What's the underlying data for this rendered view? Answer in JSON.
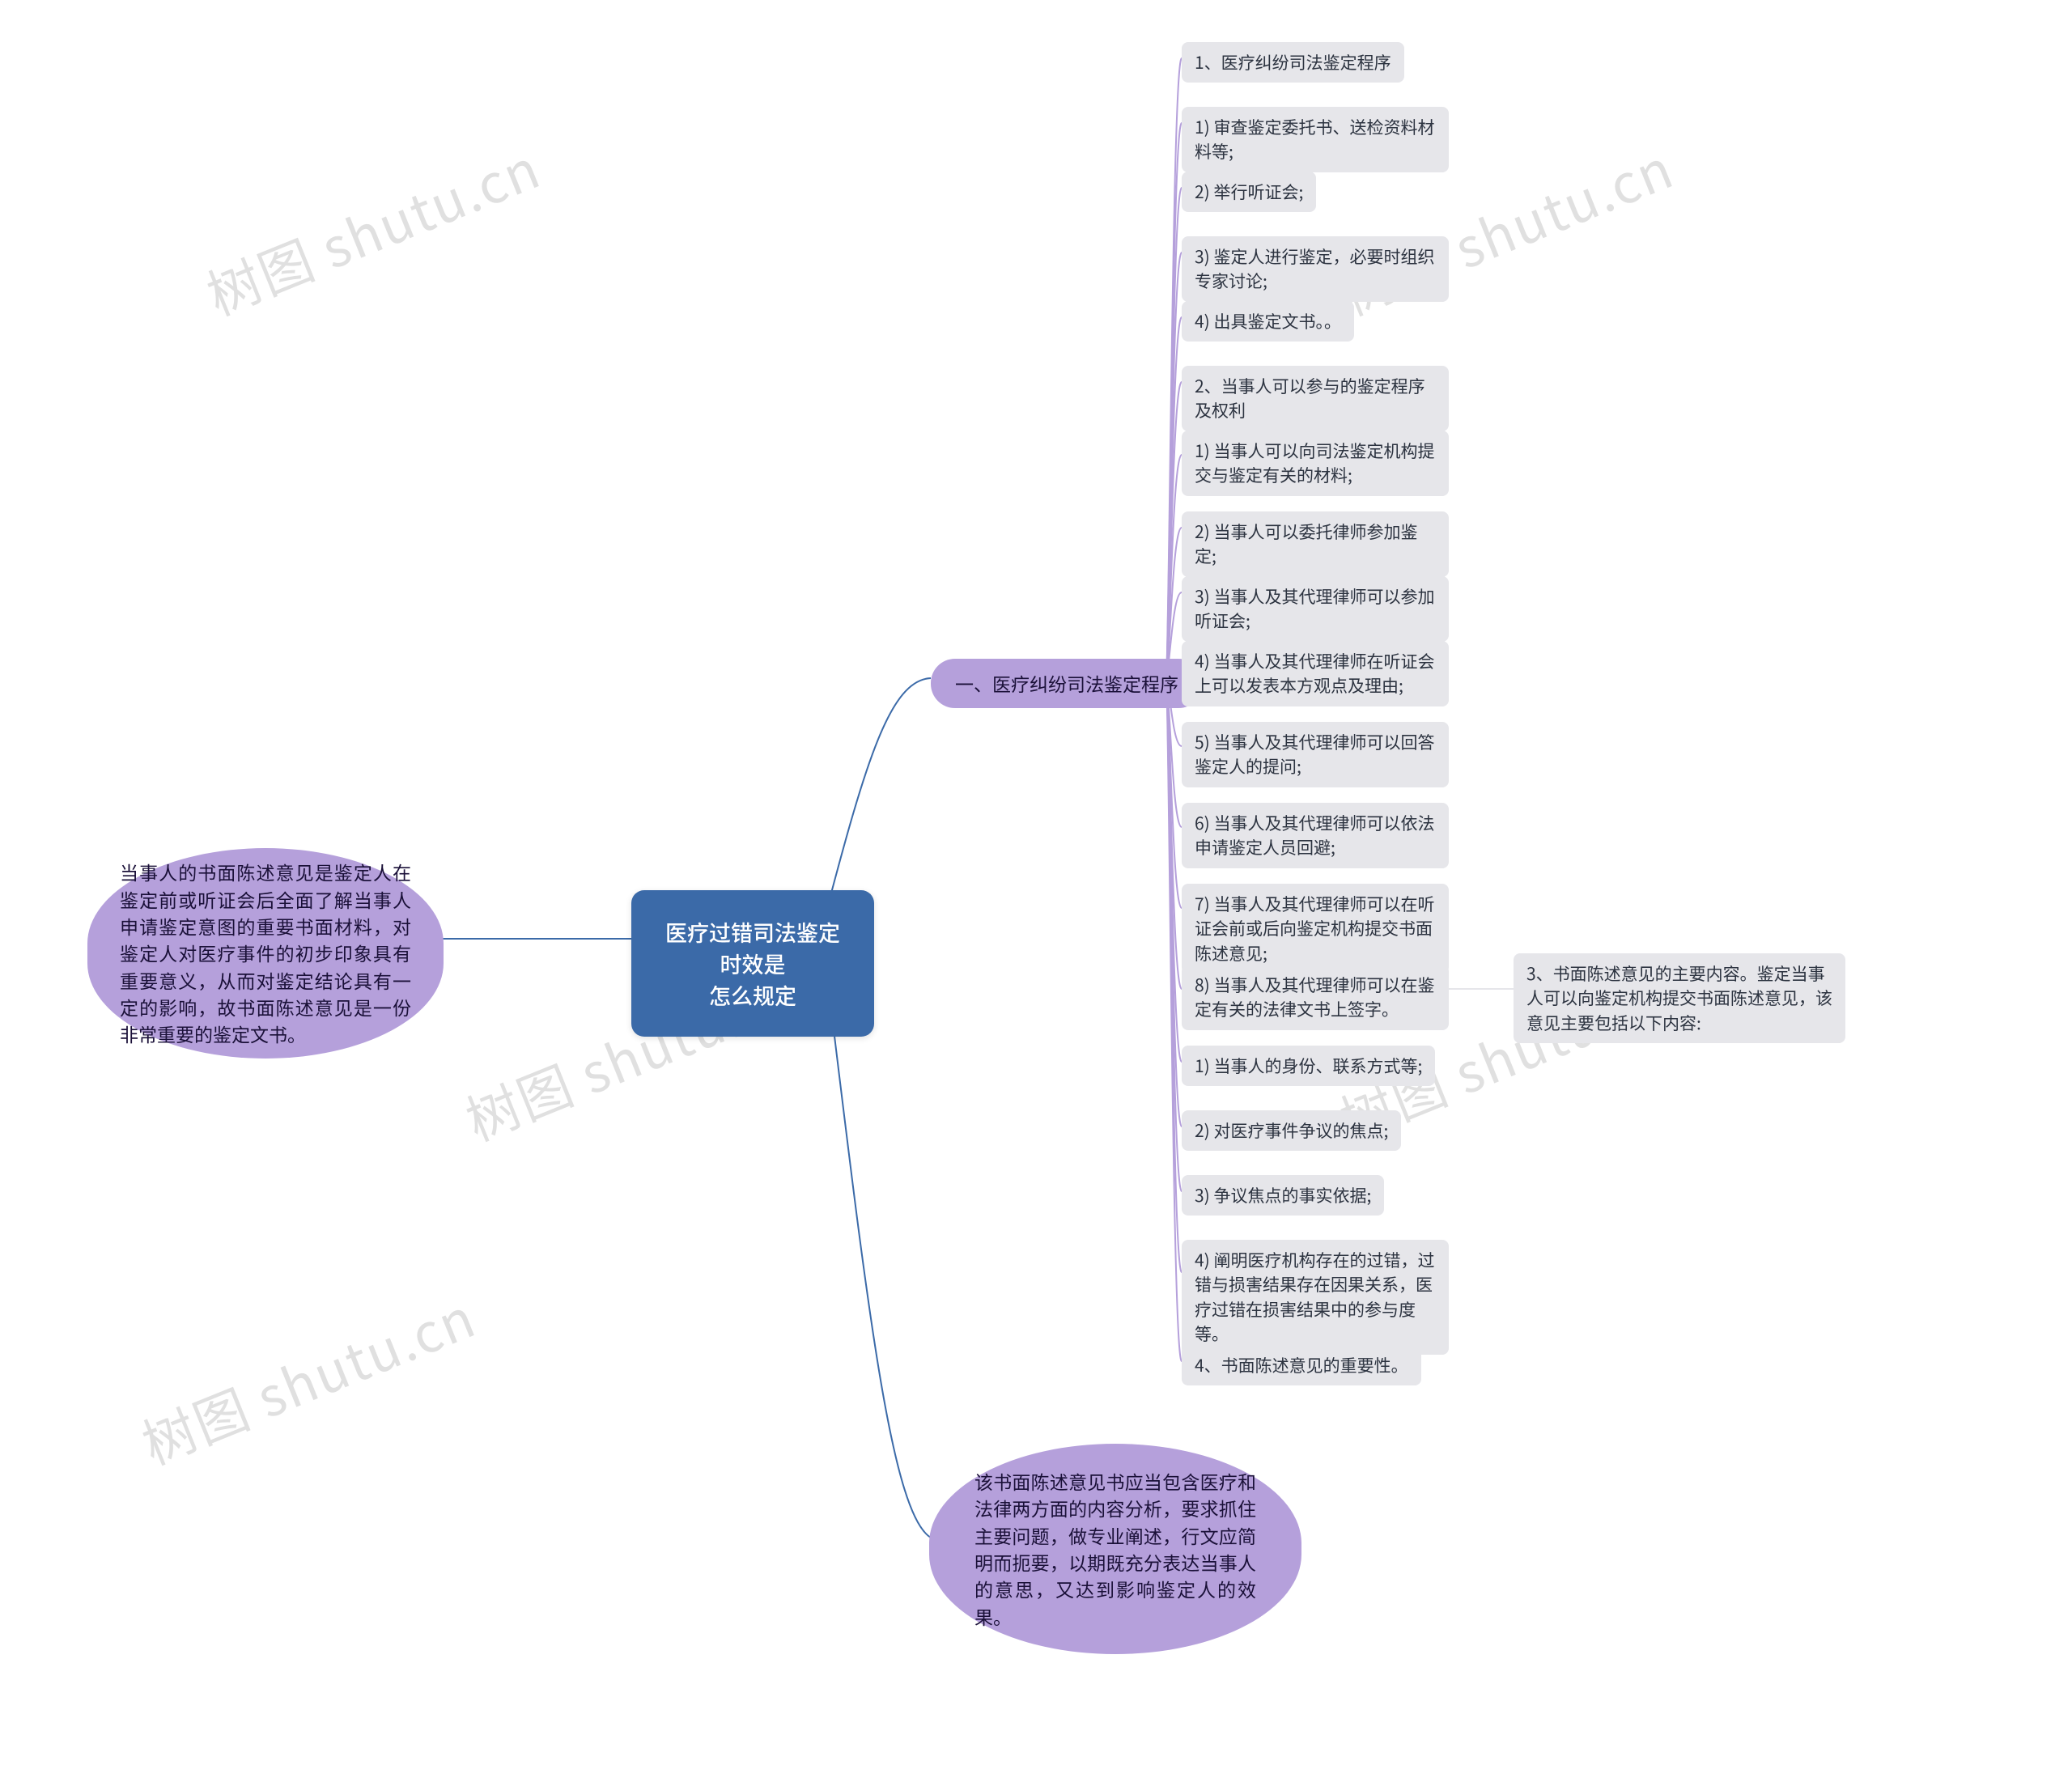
{
  "root": {
    "title_line1": "医疗过错司法鉴定时效是",
    "title_line2": "怎么规定"
  },
  "left_note": "当事人的书面陈述意见是鉴定人在鉴定前或听证会后全面了解当事人申请鉴定意图的重要书面材料，对鉴定人对医疗事件的初步印象具有重要意义，从而对鉴定结论具有一定的影响，故书面陈述意见是一份非常重要的鉴定文书。",
  "bottom_note": "该书面陈述意见书应当包含医疗和法律两方面的内容分析，要求抓住主要问题，做专业阐述，行文应简明而扼要，以期既充分表达当事人的意思，又达到影响鉴定人的效果。",
  "mid": {
    "label": "一、医疗纠纷司法鉴定程序"
  },
  "mid_leaves": {
    "l1": "1、医疗纠纷司法鉴定程序",
    "l2": "1) 审查鉴定委托书、送检资料材料等;",
    "l3": "2) 举行听证会;",
    "l4": "3) 鉴定人进行鉴定，必要时组织专家讨论;",
    "l5": "4) 出具鉴定文书。。",
    "l6": "2、当事人可以参与的鉴定程序及权利",
    "l7": "1) 当事人可以向司法鉴定机构提交与鉴定有关的材料;",
    "l8": "2) 当事人可以委托律师参加鉴定;",
    "l9": "3) 当事人及其代理律师可以参加听证会;",
    "l10": "4) 当事人及其代理律师在听证会上可以发表本方观点及理由;",
    "l11": "5) 当事人及其代理律师可以回答鉴定人的提问;",
    "l12": "6) 当事人及其代理律师可以依法申请鉴定人员回避;",
    "l13": "7) 当事人及其代理律师可以在听证会前或后向鉴定机构提交书面陈述意见;",
    "l14": "8) 当事人及其代理律师可以在鉴定有关的法律文书上签字。",
    "l14_sub": "3、书面陈述意见的主要内容。鉴定当事人可以向鉴定机构提交书面陈述意见，该意见主要包括以下内容:",
    "l15": "1) 当事人的身份、联系方式等;",
    "l16": "2) 对医疗事件争议的焦点;",
    "l17": "3) 争议焦点的事实依据;",
    "l18": "4) 阐明医疗机构存在的过错，过错与损害结果存在因果关系，医疗过错在损害结果中的参与度等。",
    "l19": "4、书面陈述意见的重要性。"
  },
  "watermark": "树图 shutu.cn"
}
